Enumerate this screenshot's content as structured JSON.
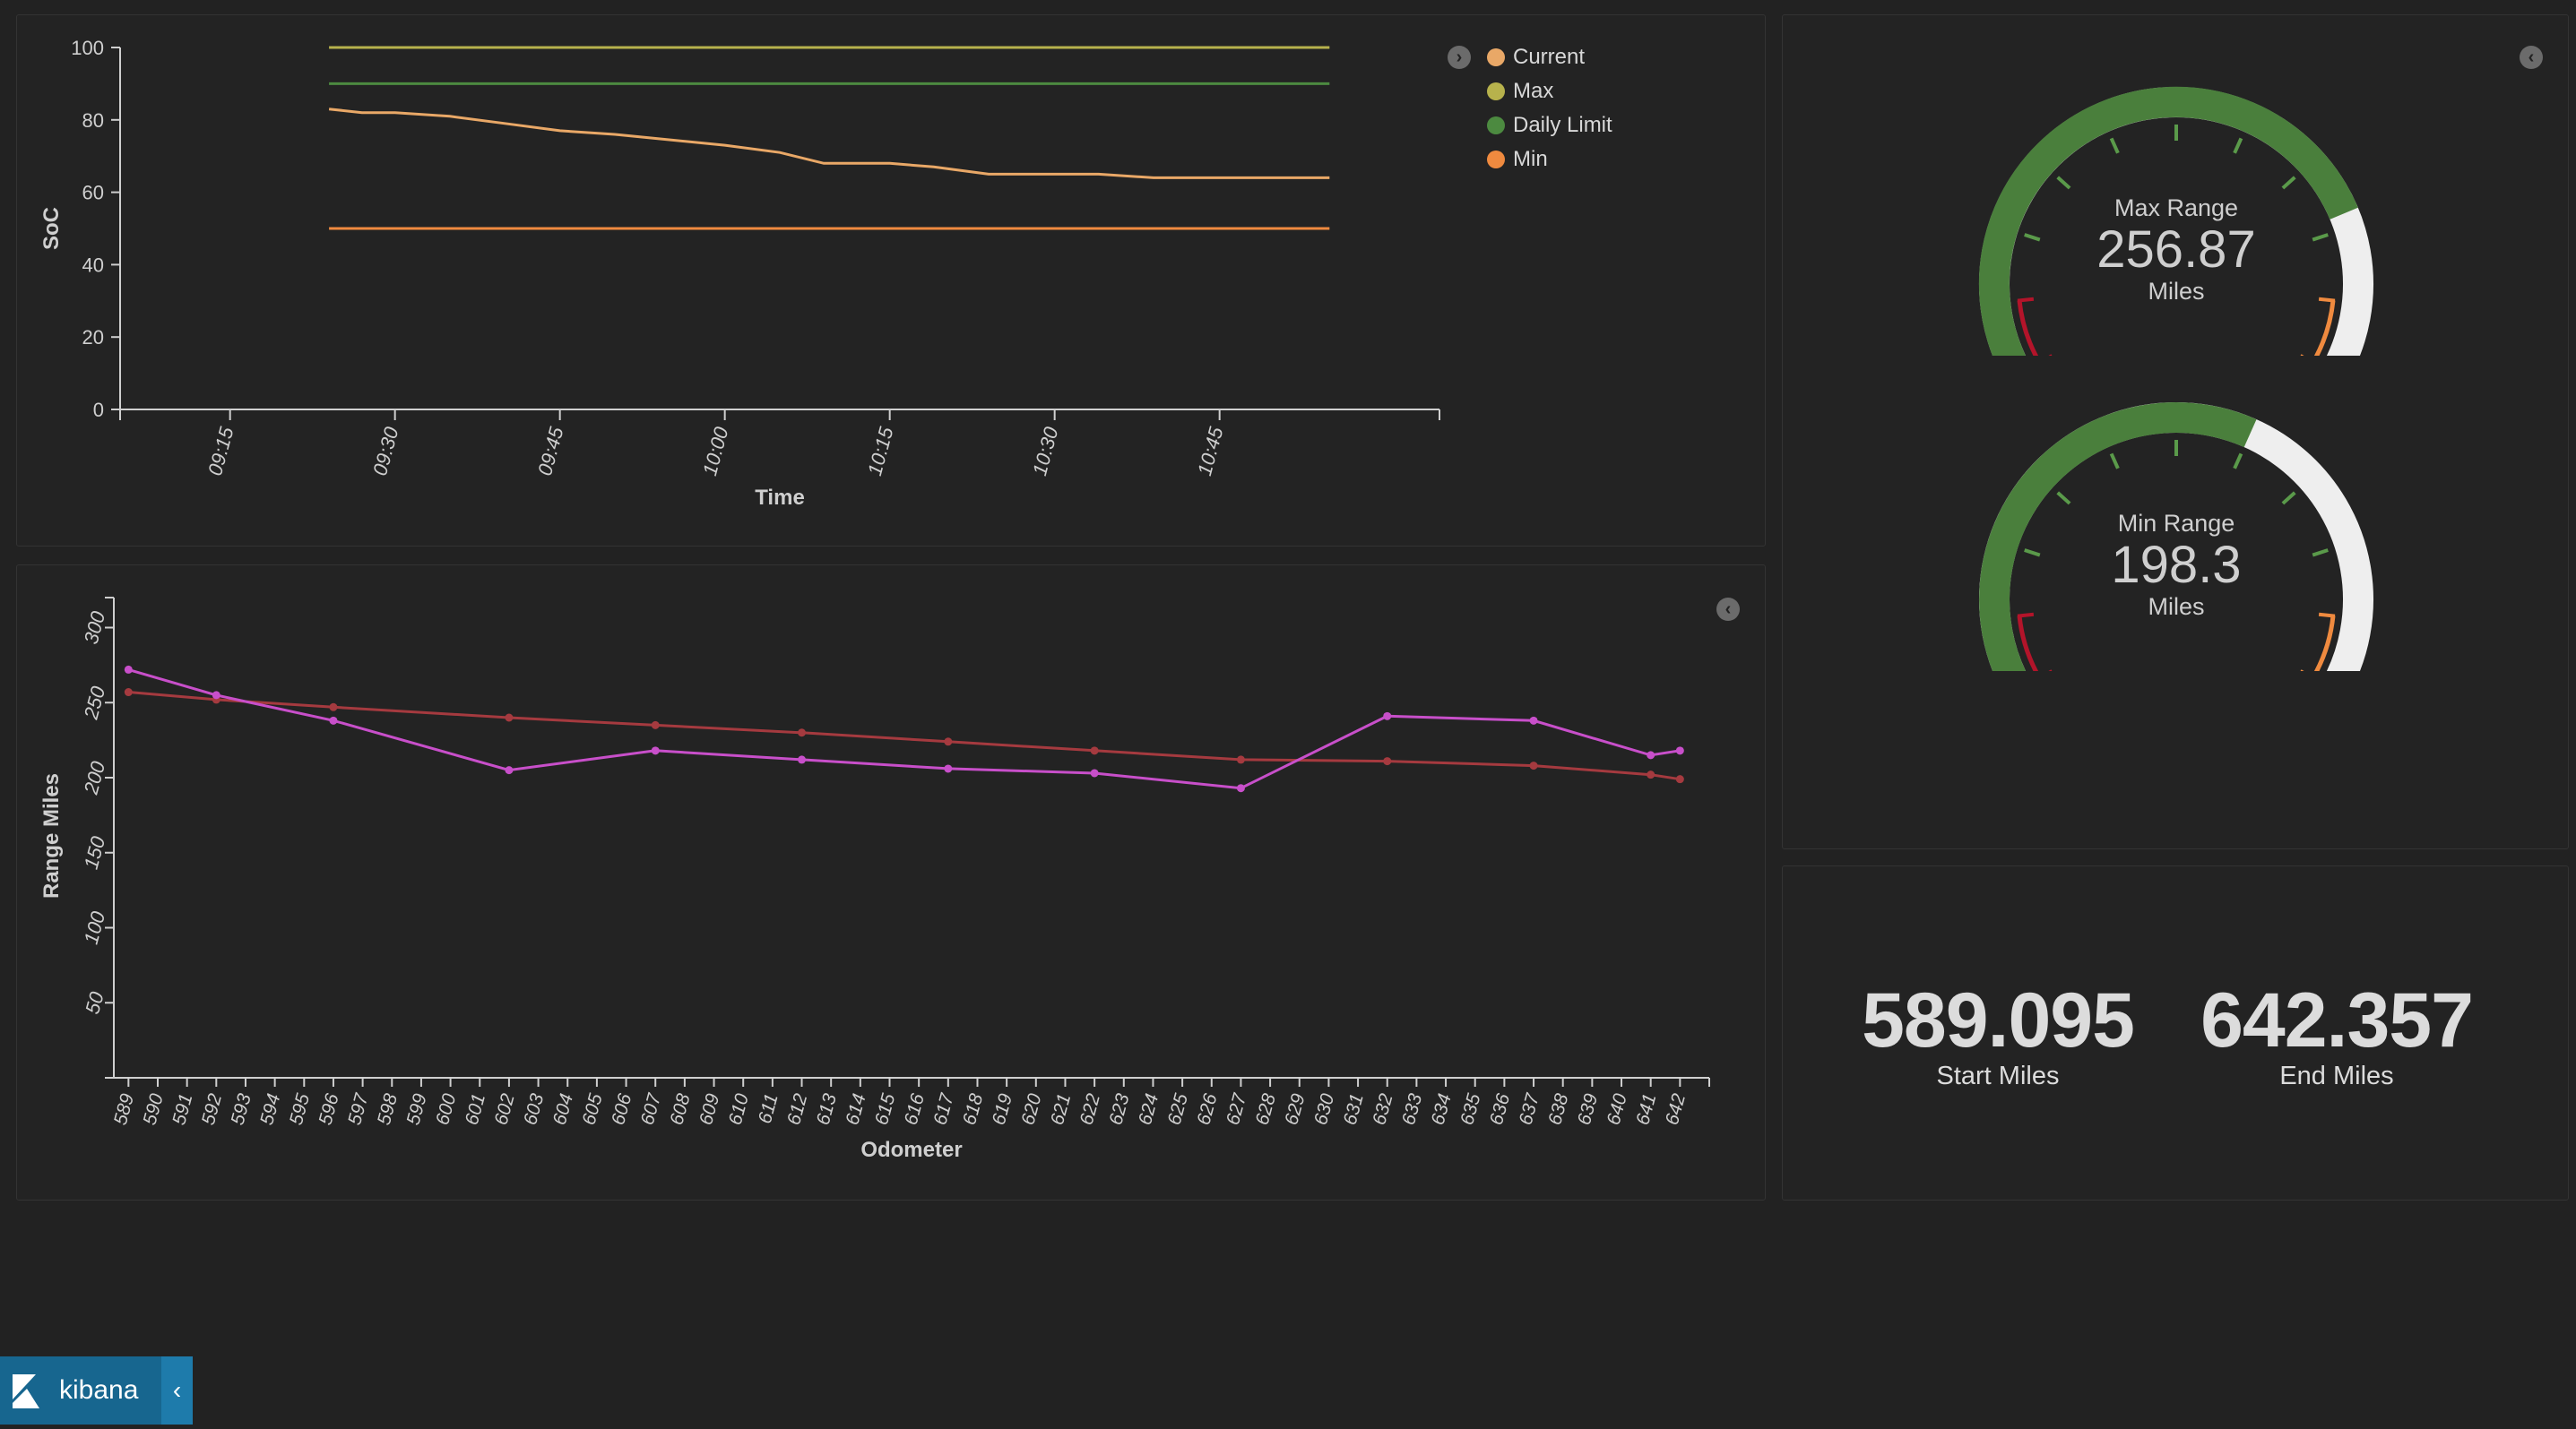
{
  "soc_chart": {
    "chart_data": {
      "type": "line",
      "xlabel": "Time",
      "ylabel": "SoC",
      "ylim": [
        0,
        100
      ],
      "yticks": [
        0,
        20,
        40,
        60,
        80,
        100
      ],
      "xticks": [
        "09:15",
        "09:30",
        "09:45",
        "10:00",
        "10:15",
        "10:30",
        "10:45"
      ],
      "x": [
        "09:24",
        "09:27",
        "09:30",
        "09:35",
        "09:40",
        "09:45",
        "09:50",
        "10:00",
        "10:05",
        "10:09",
        "10:15",
        "10:19",
        "10:24",
        "10:30",
        "10:34",
        "10:39",
        "10:45",
        "10:55"
      ],
      "series": [
        {
          "name": "Current",
          "color": "#e9a867",
          "values": [
            83,
            82,
            82,
            81,
            79,
            77,
            76,
            73,
            71,
            68,
            68,
            67,
            65,
            65,
            65,
            64,
            64,
            64
          ]
        },
        {
          "name": "Max",
          "color": "#b7b24c",
          "values": [
            100,
            100,
            100,
            100,
            100,
            100,
            100,
            100,
            100,
            100,
            100,
            100,
            100,
            100,
            100,
            100,
            100,
            100
          ]
        },
        {
          "name": "Daily Limit",
          "color": "#4c8a40",
          "values": [
            90,
            90,
            90,
            90,
            90,
            90,
            90,
            90,
            90,
            90,
            90,
            90,
            90,
            90,
            90,
            90,
            90,
            90
          ]
        },
        {
          "name": "Min",
          "color": "#ef8a3f",
          "values": [
            50,
            50,
            50,
            50,
            50,
            50,
            50,
            50,
            50,
            50,
            50,
            50,
            50,
            50,
            50,
            50,
            50,
            50
          ]
        }
      ]
    }
  },
  "range_chart": {
    "chart_data": {
      "type": "line",
      "xlabel": "Odometer",
      "ylabel": "Range Miles",
      "ylim": [
        0,
        320
      ],
      "yticks": [
        50,
        100,
        150,
        200,
        250,
        300
      ],
      "categories": [
        "589",
        "590",
        "591",
        "592",
        "593",
        "594",
        "595",
        "596",
        "597",
        "598",
        "599",
        "600",
        "601",
        "602",
        "603",
        "604",
        "605",
        "606",
        "607",
        "608",
        "609",
        "610",
        "611",
        "612",
        "613",
        "614",
        "615",
        "616",
        "617",
        "618",
        "619",
        "620",
        "621",
        "622",
        "623",
        "624",
        "625",
        "626",
        "627",
        "628",
        "629",
        "630",
        "631",
        "632",
        "633",
        "634",
        "635",
        "636",
        "637",
        "638",
        "639",
        "640",
        "641",
        "642"
      ],
      "series": [
        {
          "color": "#c84fca",
          "x": [
            589,
            592,
            596,
            602,
            607,
            612,
            617,
            622,
            627,
            632,
            637,
            641,
            642
          ],
          "values": [
            272,
            255,
            238,
            205,
            218,
            212,
            206,
            203,
            193,
            241,
            238,
            215,
            218
          ]
        },
        {
          "color": "#a53a3f",
          "x": [
            589,
            592,
            596,
            602,
            607,
            612,
            617,
            622,
            627,
            632,
            637,
            641,
            642
          ],
          "values": [
            257,
            252,
            247,
            240,
            235,
            230,
            224,
            218,
            212,
            211,
            208,
            202,
            199
          ]
        }
      ]
    }
  },
  "gauges": [
    {
      "label": "Max Range",
      "value": "256.87",
      "unit": "Miles",
      "fraction": 0.78
    },
    {
      "label": "Min Range",
      "value": "198.3",
      "unit": "Miles",
      "fraction": 0.6
    }
  ],
  "metrics": [
    {
      "value": "589.095",
      "label": "Start Miles"
    },
    {
      "value": "642.357",
      "label": "End Miles"
    }
  ],
  "colors": {
    "gauge_fill": "#4a7f3c",
    "gauge_empty": "#eeeeee",
    "gauge_red": "#b3142a",
    "gauge_orange": "#ef8a3f",
    "brand": "#17668f"
  },
  "icons": {
    "panel_toggle": "chevron-circle-icon",
    "logo": "kibana-logo-icon"
  },
  "brand": {
    "name": "kibana",
    "collapse": "‹"
  }
}
